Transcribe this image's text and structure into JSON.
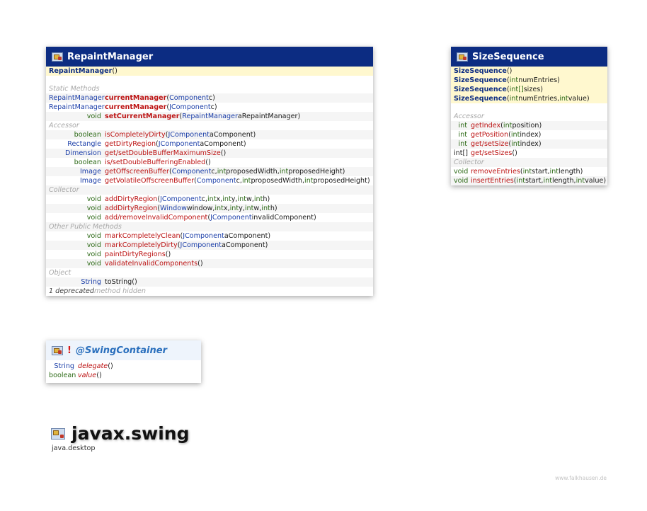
{
  "repaint_manager": {
    "title": "RepaintManager",
    "constructor": {
      "name": "RepaintManager",
      "params": " ()"
    },
    "sections": [
      {
        "label": "Static Methods",
        "rows": [
          {
            "ret": "RepaintManager",
            "ret_kind": "obj",
            "name": "currentManager",
            "name_style": "bold",
            "params": [
              {
                "t": " (",
                "k": "plain"
              },
              {
                "t": "Component",
                "k": "obj"
              },
              {
                "t": " c)",
                "k": "plain"
              }
            ]
          },
          {
            "ret": "RepaintManager",
            "ret_kind": "obj",
            "name": "currentManager",
            "name_style": "bold",
            "params": [
              {
                "t": " (",
                "k": "plain"
              },
              {
                "t": "JComponent",
                "k": "obj"
              },
              {
                "t": " c)",
                "k": "plain"
              }
            ]
          },
          {
            "ret": "void",
            "ret_kind": "prim",
            "name": "setCurrentManager",
            "name_style": "bold",
            "params": [
              {
                "t": " (",
                "k": "plain"
              },
              {
                "t": "RepaintManager",
                "k": "obj"
              },
              {
                "t": " aRepaintManager)",
                "k": "plain"
              }
            ]
          }
        ]
      },
      {
        "label": "Accessor",
        "rows": [
          {
            "ret": "boolean",
            "ret_kind": "prim",
            "name": "isCompletelyDirty",
            "name_style": "normal",
            "params": [
              {
                "t": " (",
                "k": "plain"
              },
              {
                "t": "JComponent",
                "k": "obj"
              },
              {
                "t": " aComponent)",
                "k": "plain"
              }
            ]
          },
          {
            "ret": "Rectangle",
            "ret_kind": "obj",
            "name": "getDirtyRegion",
            "name_style": "normal",
            "params": [
              {
                "t": " (",
                "k": "plain"
              },
              {
                "t": "JComponent",
                "k": "obj"
              },
              {
                "t": " aComponent)",
                "k": "plain"
              }
            ]
          },
          {
            "ret": "Dimension",
            "ret_kind": "obj",
            "name": "get/setDoubleBufferMaximumSize",
            "name_style": "normal",
            "params": [
              {
                "t": " ()",
                "k": "plain"
              }
            ]
          },
          {
            "ret": "boolean",
            "ret_kind": "prim",
            "name": "is/setDoubleBufferingEnabled",
            "name_style": "normal",
            "params": [
              {
                "t": " ()",
                "k": "plain"
              }
            ]
          },
          {
            "ret": "Image",
            "ret_kind": "obj",
            "name": "getOffscreenBuffer",
            "name_style": "normal",
            "params": [
              {
                "t": " (",
                "k": "plain"
              },
              {
                "t": "Component",
                "k": "obj"
              },
              {
                "t": " c, ",
                "k": "plain"
              },
              {
                "t": "int",
                "k": "prim"
              },
              {
                "t": " proposedWidth, ",
                "k": "plain"
              },
              {
                "t": "int",
                "k": "prim"
              },
              {
                "t": " proposedHeight)",
                "k": "plain"
              }
            ]
          },
          {
            "ret": "Image",
            "ret_kind": "obj",
            "name": "getVolatileOffscreenBuffer",
            "name_style": "normal",
            "params": [
              {
                "t": " (",
                "k": "plain"
              },
              {
                "t": "Component",
                "k": "obj"
              },
              {
                "t": " c, ",
                "k": "plain"
              },
              {
                "t": "int",
                "k": "prim"
              },
              {
                "t": " proposedWidth, ",
                "k": "plain"
              },
              {
                "t": "int",
                "k": "prim"
              },
              {
                "t": " proposedHeight)",
                "k": "plain"
              }
            ]
          }
        ]
      },
      {
        "label": "Collector",
        "rows": [
          {
            "ret": "void",
            "ret_kind": "prim",
            "name": "addDirtyRegion",
            "name_style": "normal",
            "params": [
              {
                "t": " (",
                "k": "plain"
              },
              {
                "t": "JComponent",
                "k": "obj"
              },
              {
                "t": " c, ",
                "k": "plain"
              },
              {
                "t": "int",
                "k": "prim"
              },
              {
                "t": " x, ",
                "k": "plain"
              },
              {
                "t": "int",
                "k": "prim"
              },
              {
                "t": " y, ",
                "k": "plain"
              },
              {
                "t": "int",
                "k": "prim"
              },
              {
                "t": " w, ",
                "k": "plain"
              },
              {
                "t": "int",
                "k": "prim"
              },
              {
                "t": " h)",
                "k": "plain"
              }
            ]
          },
          {
            "ret": "void",
            "ret_kind": "prim",
            "name": "addDirtyRegion",
            "name_style": "normal",
            "params": [
              {
                "t": " (",
                "k": "plain"
              },
              {
                "t": "Window",
                "k": "obj"
              },
              {
                "t": " window, ",
                "k": "plain"
              },
              {
                "t": "int",
                "k": "prim"
              },
              {
                "t": " x, ",
                "k": "plain"
              },
              {
                "t": "int",
                "k": "prim"
              },
              {
                "t": " y, ",
                "k": "plain"
              },
              {
                "t": "int",
                "k": "prim"
              },
              {
                "t": " w, ",
                "k": "plain"
              },
              {
                "t": "int",
                "k": "prim"
              },
              {
                "t": " h)",
                "k": "plain"
              }
            ]
          },
          {
            "ret": "void",
            "ret_kind": "prim",
            "name": "add/removeInvalidComponent",
            "name_style": "normal",
            "params": [
              {
                "t": " (",
                "k": "plain"
              },
              {
                "t": "JComponent",
                "k": "obj"
              },
              {
                "t": " invalidComponent)",
                "k": "plain"
              }
            ]
          }
        ]
      },
      {
        "label": "Other Public Methods",
        "rows": [
          {
            "ret": "void",
            "ret_kind": "prim",
            "name": "markCompletelyClean",
            "name_style": "normal",
            "params": [
              {
                "t": " (",
                "k": "plain"
              },
              {
                "t": "JComponent",
                "k": "obj"
              },
              {
                "t": " aComponent)",
                "k": "plain"
              }
            ]
          },
          {
            "ret": "void",
            "ret_kind": "prim",
            "name": "markCompletelyDirty",
            "name_style": "normal",
            "params": [
              {
                "t": " (",
                "k": "plain"
              },
              {
                "t": "JComponent",
                "k": "obj"
              },
              {
                "t": " aComponent)",
                "k": "plain"
              }
            ]
          },
          {
            "ret": "void",
            "ret_kind": "prim",
            "name": "paintDirtyRegions",
            "name_style": "normal",
            "params": [
              {
                "t": " ()",
                "k": "plain"
              }
            ]
          },
          {
            "ret": "void",
            "ret_kind": "prim",
            "name": "validateInvalidComponents",
            "name_style": "normal",
            "params": [
              {
                "t": " ()",
                "k": "plain"
              }
            ]
          }
        ]
      },
      {
        "label": "Object",
        "rows": [
          {
            "ret": "String",
            "ret_kind": "obj",
            "name": "toString",
            "name_style": "plain",
            "params": [
              {
                "t": " ()",
                "k": "plain"
              }
            ]
          }
        ]
      }
    ],
    "footer": {
      "count": "1 deprecated",
      "text": " method hidden"
    }
  },
  "size_sequence": {
    "title": "SizeSequence",
    "constructors": [
      {
        "name": "SizeSequence",
        "params": [
          {
            "t": " ()",
            "k": "plain"
          }
        ]
      },
      {
        "name": "SizeSequence",
        "params": [
          {
            "t": " (",
            "k": "plain"
          },
          {
            "t": "int",
            "k": "prim"
          },
          {
            "t": " numEntries)",
            "k": "plain"
          }
        ]
      },
      {
        "name": "SizeSequence",
        "params": [
          {
            "t": " (",
            "k": "plain"
          },
          {
            "t": "int[]",
            "k": "prim"
          },
          {
            "t": " sizes)",
            "k": "plain"
          }
        ]
      },
      {
        "name": "SizeSequence",
        "params": [
          {
            "t": " (",
            "k": "plain"
          },
          {
            "t": "int",
            "k": "prim"
          },
          {
            "t": " numEntries, ",
            "k": "plain"
          },
          {
            "t": "int",
            "k": "prim"
          },
          {
            "t": " value)",
            "k": "plain"
          }
        ]
      }
    ],
    "sections": [
      {
        "label": "Accessor",
        "rows": [
          {
            "ret": "int",
            "ret_kind": "prim",
            "name": "getIndex",
            "name_style": "normal",
            "params": [
              {
                "t": " (",
                "k": "plain"
              },
              {
                "t": "int",
                "k": "prim"
              },
              {
                "t": " position)",
                "k": "plain"
              }
            ]
          },
          {
            "ret": "int",
            "ret_kind": "prim",
            "name": "getPosition",
            "name_style": "normal",
            "params": [
              {
                "t": " (",
                "k": "plain"
              },
              {
                "t": "int",
                "k": "prim"
              },
              {
                "t": " index)",
                "k": "plain"
              }
            ]
          },
          {
            "ret": "int",
            "ret_kind": "prim",
            "name": "get/setSize",
            "name_style": "normal",
            "params": [
              {
                "t": " (",
                "k": "plain"
              },
              {
                "t": "int",
                "k": "prim"
              },
              {
                "t": " index)",
                "k": "plain"
              }
            ]
          },
          {
            "ret": "int[]",
            "ret_kind": "plain",
            "name": "get/setSizes",
            "name_style": "normal",
            "params": [
              {
                "t": " ()",
                "k": "plain"
              }
            ]
          }
        ]
      },
      {
        "label": "Collector",
        "rows": [
          {
            "ret": "void",
            "ret_kind": "prim",
            "name": "removeEntries",
            "name_style": "normal",
            "params": [
              {
                "t": " (",
                "k": "plain"
              },
              {
                "t": "int",
                "k": "prim"
              },
              {
                "t": " start, ",
                "k": "plain"
              },
              {
                "t": "int",
                "k": "prim"
              },
              {
                "t": " length)",
                "k": "plain"
              }
            ]
          },
          {
            "ret": "void",
            "ret_kind": "prim",
            "name": "insertEntries",
            "name_style": "normal",
            "params": [
              {
                "t": " (",
                "k": "plain"
              },
              {
                "t": "int",
                "k": "prim"
              },
              {
                "t": " start, ",
                "k": "plain"
              },
              {
                "t": "int",
                "k": "prim"
              },
              {
                "t": " length, ",
                "k": "plain"
              },
              {
                "t": "int",
                "k": "prim"
              },
              {
                "t": " value)",
                "k": "plain"
              }
            ]
          }
        ]
      }
    ]
  },
  "swing_container": {
    "marker": "!",
    "title": "@SwingContainer",
    "rows": [
      {
        "ret": "String",
        "ret_kind": "obj",
        "name": "delegate",
        "params": " ()"
      },
      {
        "ret": "boolean",
        "ret_kind": "prim",
        "name": "value",
        "params": " ()"
      }
    ]
  },
  "package": {
    "name": "javax.swing",
    "module": "java.desktop"
  },
  "credit": "www.falkhausen.de",
  "colors": {
    "header": "#0c2c82",
    "object_type": "#1b3ea8",
    "primitive_type": "#2d6a17",
    "method": "#bc1212",
    "constructor_bg": "#fff8cf"
  }
}
